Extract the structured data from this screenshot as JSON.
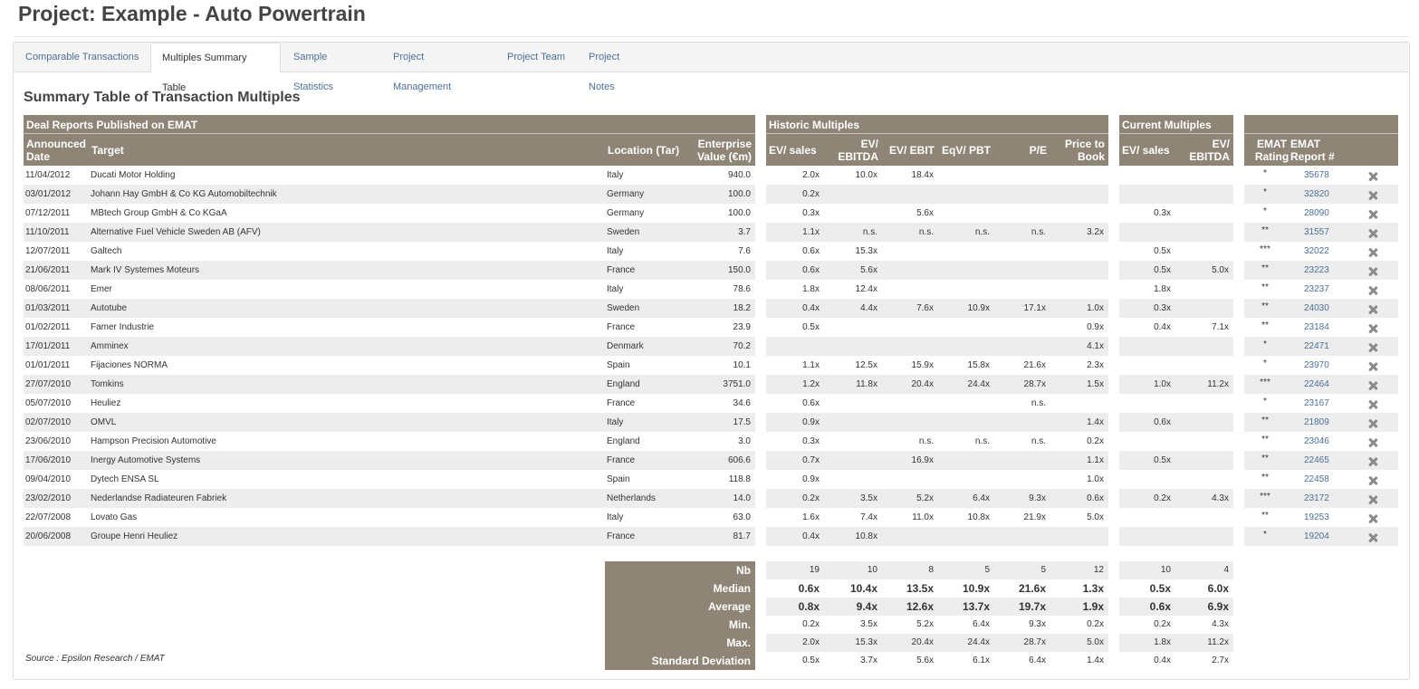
{
  "page": {
    "title": "Project: Example - Auto Powertrain"
  },
  "tabs": [
    {
      "label": "Comparable Transactions",
      "active": false
    },
    {
      "label": "Multiples Summary Table",
      "active": true
    },
    {
      "label": "Sample Statistics",
      "active": false
    },
    {
      "label": "Project Management",
      "active": false
    },
    {
      "label": "Project Team",
      "active": false
    },
    {
      "label": "Project Notes",
      "active": false
    }
  ],
  "section_title": "Summary Table of Transaction Multiples",
  "groups": {
    "deal": "Deal Reports Published on EMAT",
    "historic": "Historic Multiples",
    "current": "Current Multiples"
  },
  "columns": {
    "date": "Announced Date",
    "target": "Target",
    "location": "Location (Tar)",
    "ev": "Enterprise Value (€m)",
    "h_ev_sales": "EV/ sales",
    "h_ev_ebitda": "EV/ EBITDA",
    "h_ev_ebit": "EV/ EBIT",
    "h_eqv_pbt": "EqV/ PBT",
    "h_pe": "P/E",
    "h_ptb": "Price to Book",
    "c_ev_sales": "EV/ sales",
    "c_ev_ebitda": "EV/ EBITDA",
    "rating": "EMAT Rating",
    "report": "EMAT Report #"
  },
  "rows": [
    {
      "date": "11/04/2012",
      "target": "Ducati Motor Holding",
      "location": "Italy",
      "ev": "940.0",
      "h": [
        "2.0x",
        "10.0x",
        "18.4x",
        "",
        "",
        ""
      ],
      "c": [
        "",
        ""
      ],
      "rating": "*",
      "report": "35678"
    },
    {
      "date": "03/01/2012",
      "target": "Johann Hay GmbH & Co KG Automobiltechnik",
      "location": "Germany",
      "ev": "100.0",
      "h": [
        "0.2x",
        "",
        "",
        "",
        "",
        ""
      ],
      "c": [
        "",
        ""
      ],
      "rating": "*",
      "report": "32820"
    },
    {
      "date": "07/12/2011",
      "target": "MBtech Group GmbH & Co KGaA",
      "location": "Germany",
      "ev": "100.0",
      "h": [
        "0.3x",
        "",
        "5.6x",
        "",
        "",
        ""
      ],
      "c": [
        "0.3x",
        ""
      ],
      "rating": "*",
      "report": "28090"
    },
    {
      "date": "11/10/2011",
      "target": "Alternative Fuel Vehicle Sweden AB (AFV)",
      "location": "Sweden",
      "ev": "3.7",
      "h": [
        "1.1x",
        "n.s.",
        "n.s.",
        "n.s.",
        "n.s.",
        "3.2x"
      ],
      "c": [
        "",
        ""
      ],
      "rating": "**",
      "report": "31557"
    },
    {
      "date": "12/07/2011",
      "target": "Galtech",
      "location": "Italy",
      "ev": "7.6",
      "h": [
        "0.6x",
        "15.3x",
        "",
        "",
        "",
        ""
      ],
      "c": [
        "0.5x",
        ""
      ],
      "rating": "***",
      "report": "32022"
    },
    {
      "date": "21/06/2011",
      "target": "Mark IV Systemes Moteurs",
      "location": "France",
      "ev": "150.0",
      "h": [
        "0.6x",
        "5.6x",
        "",
        "",
        "",
        ""
      ],
      "c": [
        "0.5x",
        "5.0x"
      ],
      "rating": "**",
      "report": "23223"
    },
    {
      "date": "08/06/2011",
      "target": "Emer",
      "location": "Italy",
      "ev": "78.6",
      "h": [
        "1.8x",
        "12.4x",
        "",
        "",
        "",
        ""
      ],
      "c": [
        "1.8x",
        ""
      ],
      "rating": "**",
      "report": "23237"
    },
    {
      "date": "01/03/2011",
      "target": "Autotube",
      "location": "Sweden",
      "ev": "18.2",
      "h": [
        "0.4x",
        "4.4x",
        "7.6x",
        "10.9x",
        "17.1x",
        "1.0x"
      ],
      "c": [
        "0.3x",
        ""
      ],
      "rating": "**",
      "report": "24030"
    },
    {
      "date": "01/02/2011",
      "target": "Famer Industrie",
      "location": "France",
      "ev": "23.9",
      "h": [
        "0.5x",
        "",
        "",
        "",
        "",
        "0.9x"
      ],
      "c": [
        "0.4x",
        "7.1x"
      ],
      "rating": "**",
      "report": "23184"
    },
    {
      "date": "17/01/2011",
      "target": "Amminex",
      "location": "Denmark",
      "ev": "70.2",
      "h": [
        "",
        "",
        "",
        "",
        "",
        "4.1x"
      ],
      "c": [
        "",
        ""
      ],
      "rating": "*",
      "report": "22471"
    },
    {
      "date": "01/01/2011",
      "target": "Fijaciones NORMA",
      "location": "Spain",
      "ev": "10.1",
      "h": [
        "1.1x",
        "12.5x",
        "15.9x",
        "15.8x",
        "21.6x",
        "2.3x"
      ],
      "c": [
        "",
        ""
      ],
      "rating": "*",
      "report": "23970"
    },
    {
      "date": "27/07/2010",
      "target": "Tomkins",
      "location": "England",
      "ev": "3751.0",
      "h": [
        "1.2x",
        "11.8x",
        "20.4x",
        "24.4x",
        "28.7x",
        "1.5x"
      ],
      "c": [
        "1.0x",
        "11.2x"
      ],
      "rating": "***",
      "report": "22464"
    },
    {
      "date": "05/07/2010",
      "target": "Heuliez",
      "location": "France",
      "ev": "34.6",
      "h": [
        "0.6x",
        "",
        "",
        "",
        "n.s.",
        ""
      ],
      "c": [
        "",
        ""
      ],
      "rating": "*",
      "report": "23167"
    },
    {
      "date": "02/07/2010",
      "target": "OMVL",
      "location": "Italy",
      "ev": "17.5",
      "h": [
        "0.9x",
        "",
        "",
        "",
        "",
        "1.4x"
      ],
      "c": [
        "0.6x",
        ""
      ],
      "rating": "**",
      "report": "21809"
    },
    {
      "date": "23/06/2010",
      "target": "Hampson Precision Automotive",
      "location": "England",
      "ev": "3.0",
      "h": [
        "0.3x",
        "",
        "n.s.",
        "n.s.",
        "n.s.",
        "0.2x"
      ],
      "c": [
        "",
        ""
      ],
      "rating": "**",
      "report": "23046"
    },
    {
      "date": "17/06/2010",
      "target": "Inergy Automotive Systems",
      "location": "France",
      "ev": "606.6",
      "h": [
        "0.7x",
        "",
        "16.9x",
        "",
        "",
        "1.1x"
      ],
      "c": [
        "0.5x",
        ""
      ],
      "rating": "**",
      "report": "22465"
    },
    {
      "date": "09/04/2010",
      "target": "Dytech ENSA SL",
      "location": "Spain",
      "ev": "118.8",
      "h": [
        "0.9x",
        "",
        "",
        "",
        "",
        "1.0x"
      ],
      "c": [
        "",
        ""
      ],
      "rating": "**",
      "report": "22458"
    },
    {
      "date": "23/02/2010",
      "target": "Nederlandse Radiateuren Fabriek",
      "location": "Netherlands",
      "ev": "14.0",
      "h": [
        "0.2x",
        "3.5x",
        "5.2x",
        "6.4x",
        "9.3x",
        "0.6x"
      ],
      "c": [
        "0.2x",
        "4.3x"
      ],
      "rating": "***",
      "report": "23172"
    },
    {
      "date": "22/07/2008",
      "target": "Lovato Gas",
      "location": "Italy",
      "ev": "63.0",
      "h": [
        "1.6x",
        "7.4x",
        "11.0x",
        "10.8x",
        "21.9x",
        "5.0x"
      ],
      "c": [
        "",
        ""
      ],
      "rating": "**",
      "report": "19253"
    },
    {
      "date": "20/06/2008",
      "target": "Groupe Henri Heuliez",
      "location": "France",
      "ev": "81.7",
      "h": [
        "0.4x",
        "10.8x",
        "",
        "",
        "",
        ""
      ],
      "c": [
        "",
        ""
      ],
      "rating": "*",
      "report": "19204"
    }
  ],
  "stats": [
    {
      "label": "Nb",
      "bold": false,
      "h": [
        "19",
        "10",
        "8",
        "5",
        "5",
        "12"
      ],
      "c": [
        "10",
        "4"
      ]
    },
    {
      "label": "Median",
      "bold": true,
      "h": [
        "0.6x",
        "10.4x",
        "13.5x",
        "10.9x",
        "21.6x",
        "1.3x"
      ],
      "c": [
        "0.5x",
        "6.0x"
      ]
    },
    {
      "label": "Average",
      "bold": true,
      "h": [
        "0.8x",
        "9.4x",
        "12.6x",
        "13.7x",
        "19.7x",
        "1.9x"
      ],
      "c": [
        "0.6x",
        "6.9x"
      ]
    },
    {
      "label": "Min.",
      "bold": false,
      "h": [
        "0.2x",
        "3.5x",
        "5.2x",
        "6.4x",
        "9.3x",
        "0.2x"
      ],
      "c": [
        "0.2x",
        "4.3x"
      ]
    },
    {
      "label": "Max.",
      "bold": false,
      "h": [
        "2.0x",
        "15.3x",
        "20.4x",
        "24.4x",
        "28.7x",
        "5.0x"
      ],
      "c": [
        "1.8x",
        "11.2x"
      ]
    },
    {
      "label": "Standard Deviation",
      "bold": false,
      "h": [
        "0.5x",
        "3.7x",
        "5.6x",
        "6.1x",
        "6.4x",
        "1.4x"
      ],
      "c": [
        "0.4x",
        "2.7x"
      ]
    }
  ],
  "source": "Source : Epsilon Research / EMAT",
  "icons": {
    "delete": "delete-x-icon"
  },
  "colors": {
    "header_bg": "#8f8577",
    "link": "#4a6f96",
    "stripe": "#ededed"
  }
}
